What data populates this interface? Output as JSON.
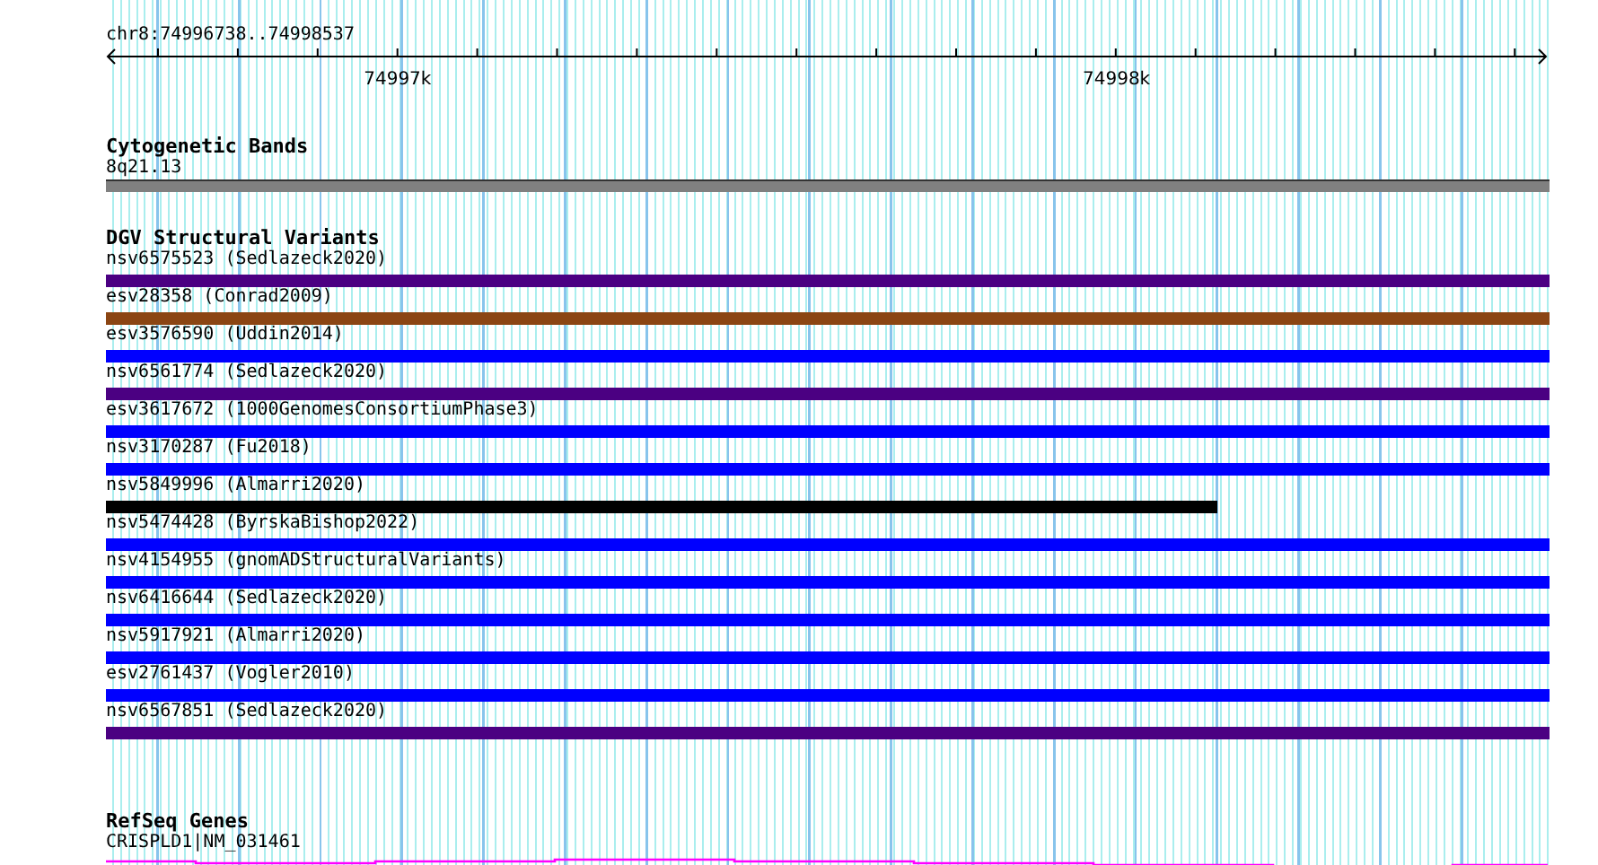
{
  "location": "chr8:74996738..74998537",
  "ruler": {
    "ticks": [
      "74997k",
      "74998k"
    ]
  },
  "cytobands": {
    "title": "Cytogenetic Bands",
    "band": "8q21.13"
  },
  "variants": {
    "title": "DGV Structural Variants",
    "features": [
      {
        "label": "nsv6575523 (Sedlazeck2020)",
        "color": "#4b0082",
        "level": 1
      },
      {
        "label": "esv28358 (Conrad2009)",
        "color": "#8b4513",
        "level": 1
      },
      {
        "label": "esv3576590 (Uddin2014)",
        "color": "#0000ff",
        "level": 1
      },
      {
        "label": "nsv6561774 (Sedlazeck2020)",
        "color": "#4b0082",
        "level": 1
      },
      {
        "label": "esv3617672 (1000GenomesConsortiumPhase3)",
        "color": "#0000ff",
        "level": 1
      },
      {
        "label": "nsv3170287 (Fu2018)",
        "color": "#0000ff",
        "level": 1
      },
      {
        "label": "nsv5849996 (Almarri2020)",
        "color": "#000000",
        "level": 0.77
      },
      {
        "label": "nsv5474428 (ByrskaBishop2022)",
        "color": "#0000ff",
        "level": 1
      },
      {
        "label": "nsv4154955 (gnomADStructuralVariants)",
        "color": "#0000ff",
        "level": 1
      },
      {
        "label": "nsv6416644 (Sedlazeck2020)",
        "color": "#0000ff",
        "level": 1
      },
      {
        "label": "nsv5917921 (Almarri2020)",
        "color": "#0000ff",
        "level": 1
      },
      {
        "label": "esv2761437 (Vogler2010)",
        "color": "#0000ff",
        "level": 1
      },
      {
        "label": "nsv6567851 (Sedlazeck2020)",
        "color": "#4b0082",
        "level": 1
      }
    ]
  },
  "genes": {
    "title": "RefSeq Genes",
    "gene": "CRISPLD1|NM_031461"
  }
}
